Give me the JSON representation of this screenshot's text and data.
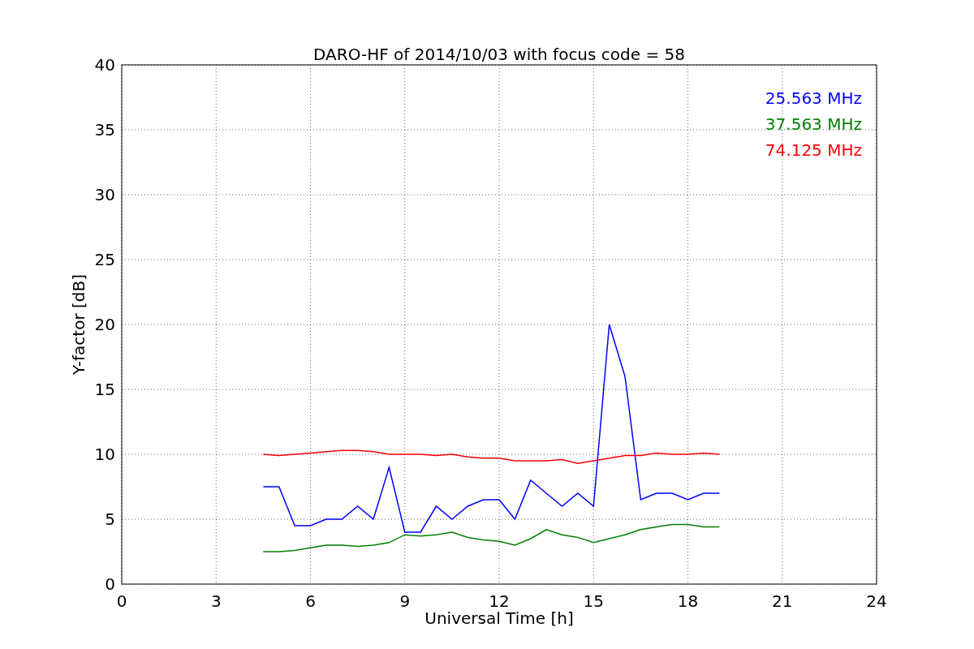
{
  "figure": {
    "chart_data": {
      "type": "line",
      "title": "DARO-HF of 2014/10/03 with focus code = 58",
      "xlabel": "Universal Time [h]",
      "ylabel": "Y-factor [dB]",
      "x": [
        4.5,
        5,
        5.5,
        6,
        6.5,
        7,
        7.5,
        8,
        8.5,
        9,
        9.5,
        10,
        10.5,
        11,
        11.5,
        12,
        12.5,
        13,
        13.5,
        14,
        14.5,
        15,
        15.5,
        16,
        16.5,
        17,
        17.5,
        18,
        18.5,
        19
      ],
      "series": [
        {
          "name": "25.563 MHz",
          "color": "#0000ff",
          "values": [
            7.5,
            7.5,
            4.5,
            4.5,
            5,
            5,
            6,
            5,
            9,
            4,
            4,
            6,
            5,
            6,
            6.5,
            6.5,
            5,
            8,
            7,
            6,
            7,
            6,
            20,
            16,
            6.5,
            7,
            7,
            6.5,
            7,
            7
          ]
        },
        {
          "name": "37.563 MHz",
          "color": "#008000",
          "values": [
            2.5,
            2.5,
            2.6,
            2.8,
            3,
            3,
            2.9,
            3,
            3.2,
            3.8,
            3.7,
            3.8,
            4,
            3.6,
            3.4,
            3.3,
            3,
            3.5,
            4.2,
            3.8,
            3.6,
            3.2,
            3.5,
            3.8,
            4.2,
            4.4,
            4.6,
            4.6,
            4.4,
            4.4
          ]
        },
        {
          "name": "74.125 MHz",
          "color": "#ff0000",
          "values": [
            10,
            9.9,
            10,
            10.1,
            10.2,
            10.3,
            10.3,
            10.2,
            10,
            10,
            10,
            9.9,
            10,
            9.8,
            9.7,
            9.7,
            9.5,
            9.5,
            9.5,
            9.6,
            9.3,
            9.5,
            9.7,
            9.9,
            9.9,
            10.1,
            10,
            10,
            10.1,
            10
          ]
        }
      ],
      "grid": true,
      "xlim": [
        0,
        24
      ],
      "ylim": [
        0,
        40
      ],
      "xticks": [
        0,
        3,
        6,
        9,
        12,
        15,
        18,
        21,
        24
      ],
      "yticks": [
        0,
        5,
        10,
        15,
        20,
        25,
        30,
        35,
        40
      ]
    }
  }
}
